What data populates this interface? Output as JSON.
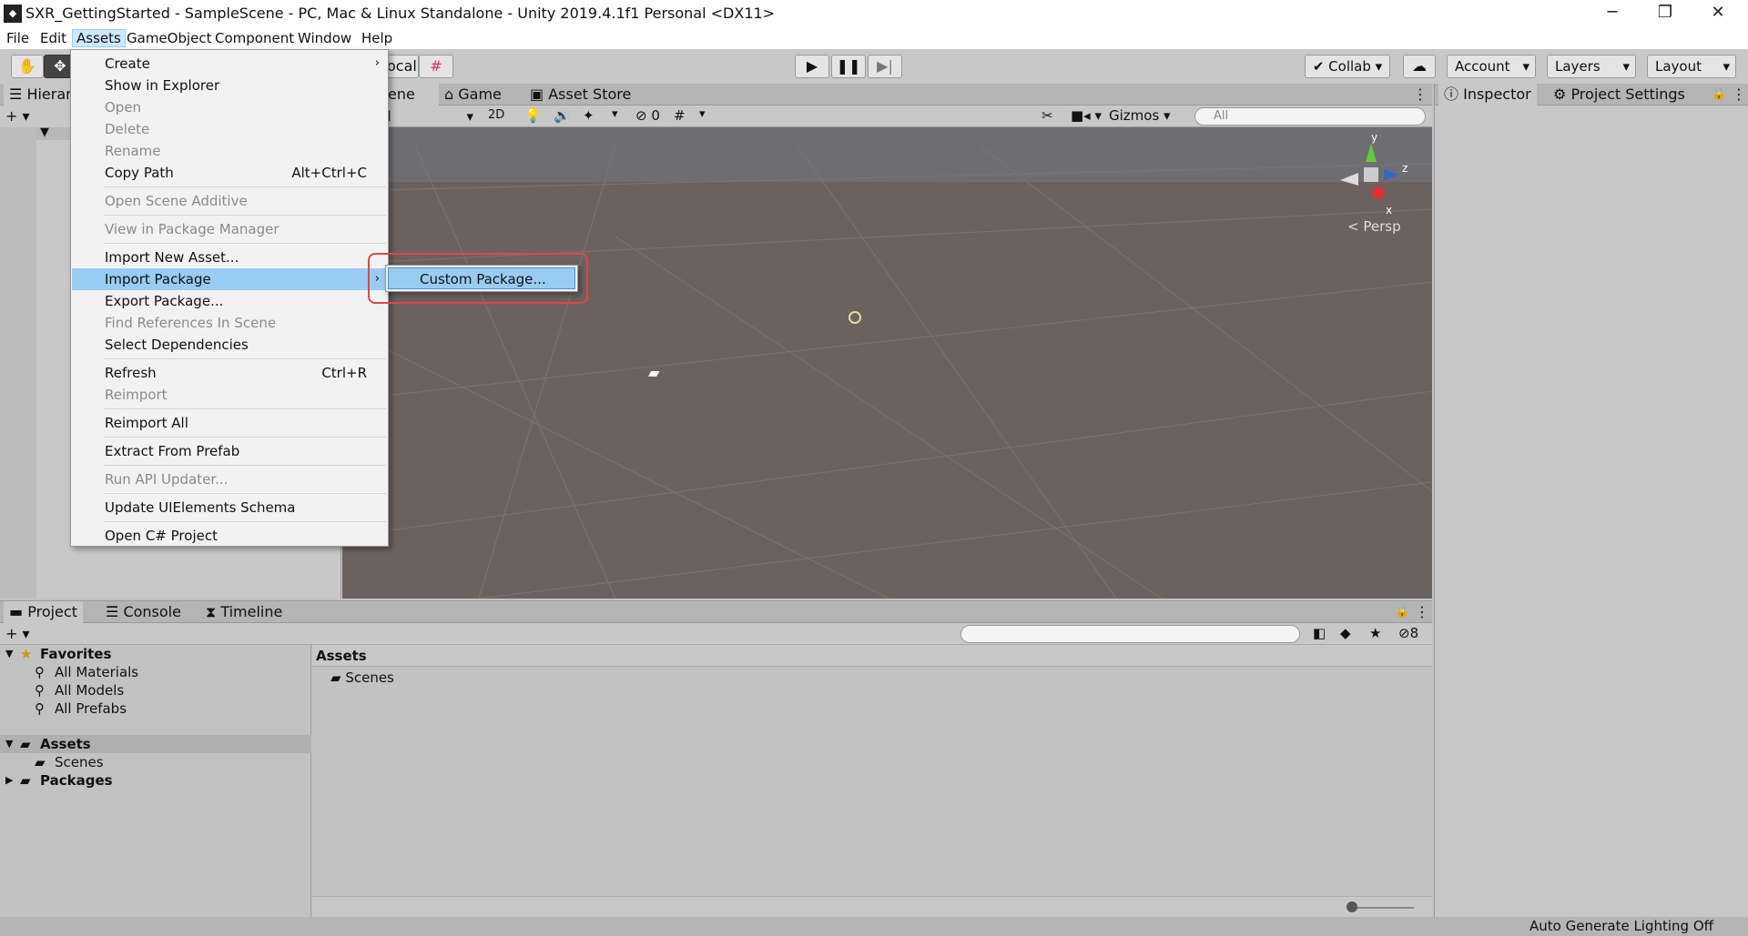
{
  "window": {
    "title": "SXR_GettingStarted - SampleScene - PC, Mac & Linux Standalone - Unity 2019.4.1f1 Personal <DX11>"
  },
  "menubar": [
    "File",
    "Edit",
    "Assets",
    "GameObject",
    "Component",
    "Window",
    "Help"
  ],
  "toolbar": {
    "pivot_label": "ocal",
    "collab_label": "Collab",
    "account_label": "Account",
    "layers_label": "Layers",
    "layout_label": "Layout"
  },
  "hierarchy": {
    "tab": "Hierarc"
  },
  "scene": {
    "tabs": [
      "ene",
      "Game",
      "Asset Store"
    ],
    "shading": "d",
    "mode_2d": "2D",
    "hidden_count": "0",
    "gizmos_label": "Gizmos",
    "search_placeholder": "All",
    "persp_label": "Persp",
    "axis": {
      "x": "x",
      "y": "y",
      "z": "z"
    }
  },
  "inspector": {
    "tabs": [
      "Inspector",
      "Project Settings"
    ]
  },
  "project": {
    "tabs": [
      "Project",
      "Console",
      "Timeline"
    ],
    "tree": {
      "favorites": "Favorites",
      "favorite_items": [
        "All Materials",
        "All Models",
        "All Prefabs"
      ],
      "assets": "Assets",
      "assets_children": [
        "Scenes"
      ],
      "packages": "Packages"
    },
    "breadcrumb": "Assets",
    "content_items": [
      "Scenes"
    ],
    "hidden_count": "8"
  },
  "statusbar": {
    "text": "Auto Generate Lighting Off"
  },
  "assets_menu": {
    "items": [
      {
        "label": "Create",
        "disabled": false,
        "submenu": true
      },
      {
        "label": "Show in Explorer",
        "disabled": false
      },
      {
        "label": "Open",
        "disabled": true
      },
      {
        "label": "Delete",
        "disabled": true
      },
      {
        "label": "Rename",
        "disabled": true
      },
      {
        "label": "Copy Path",
        "disabled": false,
        "shortcut": "Alt+Ctrl+C"
      },
      {
        "label": "Open Scene Additive",
        "disabled": true
      },
      {
        "label": "View in Package Manager",
        "disabled": true
      },
      {
        "label": "Import New Asset...",
        "disabled": false
      },
      {
        "label": "Import Package",
        "disabled": false,
        "submenu": true,
        "highlighted": true
      },
      {
        "label": "Export Package...",
        "disabled": false
      },
      {
        "label": "Find References In Scene",
        "disabled": true
      },
      {
        "label": "Select Dependencies",
        "disabled": false
      },
      {
        "label": "Refresh",
        "disabled": false,
        "shortcut": "Ctrl+R"
      },
      {
        "label": "Reimport",
        "disabled": true
      },
      {
        "label": "Reimport All",
        "disabled": false
      },
      {
        "label": "Extract From Prefab",
        "disabled": false
      },
      {
        "label": "Run API Updater...",
        "disabled": true
      },
      {
        "label": "Update UIElements Schema",
        "disabled": false
      },
      {
        "label": "Open C# Project",
        "disabled": false
      }
    ],
    "submenu_item": "Custom Package..."
  }
}
